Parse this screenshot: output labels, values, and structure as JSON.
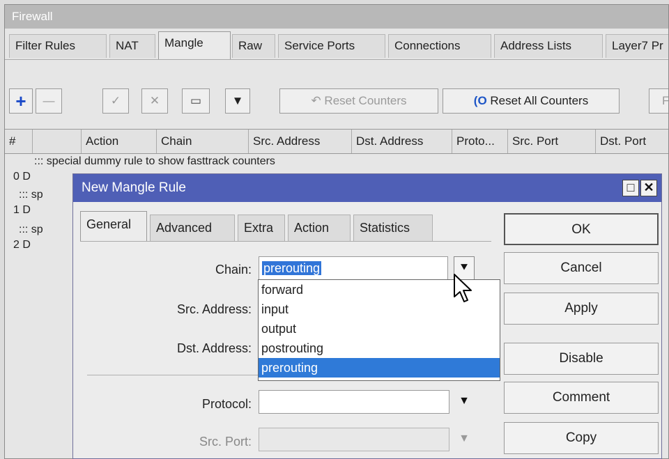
{
  "window": {
    "title": "Firewall"
  },
  "tabs": [
    "Filter Rules",
    "NAT",
    "Mangle",
    "Raw",
    "Service Ports",
    "Connections",
    "Address Lists",
    "Layer7 Pr"
  ],
  "active_tab": "Mangle",
  "toolbar": {
    "add": "+",
    "remove": "—",
    "enable": "✓",
    "disable": "✕",
    "comment": "▭",
    "filter": "▼",
    "reset_counters": "Reset Counters",
    "reset_all_counters": "Reset All Counters",
    "find": "F"
  },
  "columns": [
    "#",
    "",
    "Action",
    "Chain",
    "Src. Address",
    "Dst. Address",
    "Proto...",
    "Src. Port",
    "Dst. Port"
  ],
  "rows": [
    ":::  special dummy rule to show fasttrack counters",
    "0  D",
    "::: sp",
    "1  D",
    "::: sp",
    "2  D"
  ],
  "dialog": {
    "title": "New Mangle Rule",
    "tabs": [
      "General",
      "Advanced",
      "Extra",
      "Action",
      "Statistics"
    ],
    "active_tab": "General",
    "labels": {
      "chain": "Chain:",
      "src_address": "Src. Address:",
      "dst_address": "Dst. Address:",
      "protocol": "Protocol:",
      "src_port": "Src. Port:"
    },
    "chain_value": "prerouting",
    "chain_options": [
      "forward",
      "input",
      "output",
      "postrouting",
      "prerouting"
    ],
    "selected_option": "prerouting",
    "buttons": [
      "OK",
      "Cancel",
      "Apply",
      "Disable",
      "Comment",
      "Copy"
    ],
    "controls": {
      "maximize": "□",
      "close": "✕"
    }
  },
  "icons": {
    "dropdown_arrow": "▼",
    "dropdown_arrow_open": "⯆",
    "cursor": "pointer-cursor-icon"
  }
}
